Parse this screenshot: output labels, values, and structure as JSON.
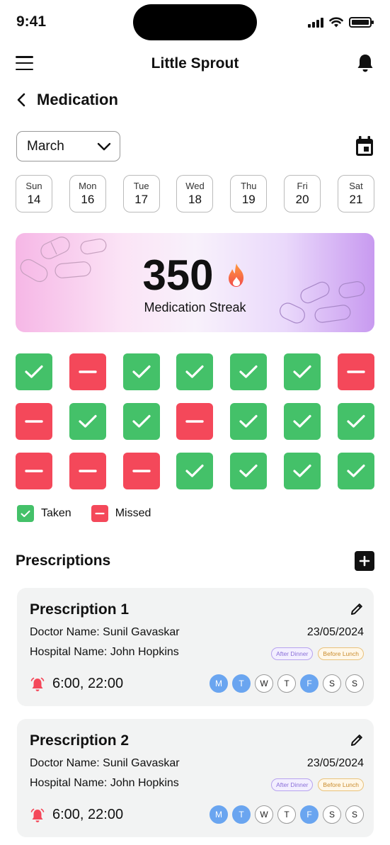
{
  "status_bar": {
    "time": "9:41"
  },
  "header": {
    "title": "Little Sprout"
  },
  "page": {
    "title": "Medication"
  },
  "month_selector": {
    "value": "March"
  },
  "days": [
    {
      "name": "Sun",
      "num": "14"
    },
    {
      "name": "Mon",
      "num": "16"
    },
    {
      "name": "Tue",
      "num": "17"
    },
    {
      "name": "Wed",
      "num": "18"
    },
    {
      "name": "Thu",
      "num": "19"
    },
    {
      "name": "Fri",
      "num": "20"
    },
    {
      "name": "Sat",
      "num": "21"
    }
  ],
  "streak": {
    "value": "350",
    "label": "Medication Streak"
  },
  "grid": [
    [
      "taken",
      "missed",
      "taken",
      "taken",
      "taken",
      "taken",
      "missed"
    ],
    [
      "missed",
      "taken",
      "taken",
      "missed",
      "taken",
      "taken",
      "taken"
    ],
    [
      "missed",
      "missed",
      "missed",
      "taken",
      "taken",
      "taken",
      "taken"
    ]
  ],
  "legend": {
    "taken": "Taken",
    "missed": "Missed"
  },
  "prescriptions_header": "Prescriptions",
  "prescriptions": [
    {
      "title": "Prescription 1",
      "doctor": "Doctor Name: Sunil Gavaskar",
      "date": "23/05/2024",
      "hospital": "Hospital Name: John Hopkins",
      "tags": [
        "After Dinner",
        "Before Lunch"
      ],
      "times": "6:00, 22:00",
      "weekdays": [
        {
          "label": "M",
          "on": true
        },
        {
          "label": "T",
          "on": true
        },
        {
          "label": "W",
          "on": false
        },
        {
          "label": "T",
          "on": false
        },
        {
          "label": "F",
          "on": true
        },
        {
          "label": "S",
          "on": false
        },
        {
          "label": "S",
          "on": false
        }
      ]
    },
    {
      "title": "Prescription 2",
      "doctor": "Doctor Name: Sunil Gavaskar",
      "date": "23/05/2024",
      "hospital": "Hospital Name: John Hopkins",
      "tags": [
        "After Dinner",
        "Before Lunch"
      ],
      "times": "6:00, 22:00",
      "weekdays": [
        {
          "label": "M",
          "on": true
        },
        {
          "label": "T",
          "on": true
        },
        {
          "label": "W",
          "on": false
        },
        {
          "label": "T",
          "on": false
        },
        {
          "label": "F",
          "on": true
        },
        {
          "label": "S",
          "on": false
        },
        {
          "label": "S",
          "on": false
        }
      ]
    }
  ],
  "colors": {
    "taken": "#44c169",
    "missed": "#f4485a",
    "weekday_active": "#6aa5f0",
    "alarm": "#f4485a"
  },
  "icons": [
    "menu-icon",
    "bell-icon",
    "back-icon",
    "chevron-down-icon",
    "calendar-icon",
    "fire-icon",
    "check-icon",
    "minus-icon",
    "plus-icon",
    "pencil-icon",
    "alarm-icon"
  ]
}
